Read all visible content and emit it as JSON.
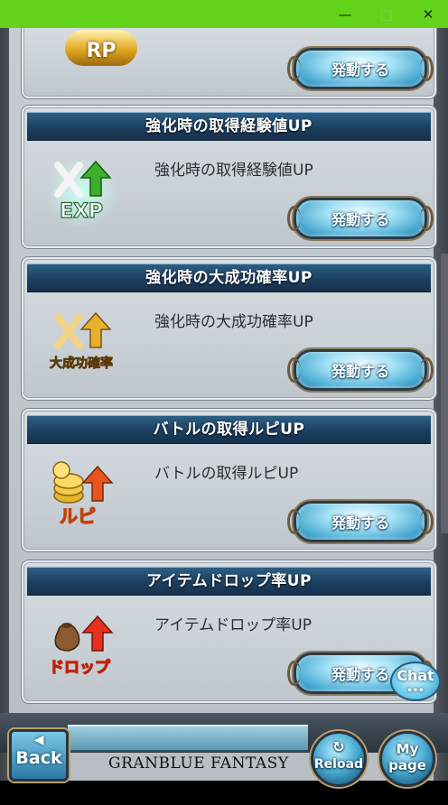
{
  "window": {
    "minimize_glyph": "—",
    "maximize_glyph": "□",
    "close_glyph": "✕"
  },
  "top_card": {
    "badge_text": "RP",
    "button_label": "発動する"
  },
  "cards": [
    {
      "title": "強化時の取得経験値UP",
      "description": "強化時の取得経験値UP",
      "icon": "exp-up-icon",
      "icon_text": "EXP",
      "button_label": "発動する"
    },
    {
      "title": "強化時の大成功確率UP",
      "description": "強化時の大成功確率UP",
      "icon": "great-success-up-icon",
      "icon_text": "大成功確率",
      "button_label": "発動する"
    },
    {
      "title": "バトルの取得ルピUP",
      "description": "バトルの取得ルピUP",
      "icon": "rupie-up-icon",
      "icon_text": "ルピ",
      "button_label": "発動する"
    },
    {
      "title": "アイテムドロップ率UP",
      "description": "アイテムドロップ率UP",
      "icon": "item-drop-up-icon",
      "icon_text": "ドロップ",
      "button_label": "発動する"
    }
  ],
  "footer": {
    "back_label": "Back",
    "logo_text": "GRANBLUE FANTASY",
    "reload_label": "Reload",
    "mypage_label_1": "My",
    "mypage_label_2": "page",
    "chat_label": "Chat"
  },
  "colors": {
    "titlebar": "#63d31a",
    "card_header": "#1c3f60",
    "button_accent": "#46a9d2"
  }
}
